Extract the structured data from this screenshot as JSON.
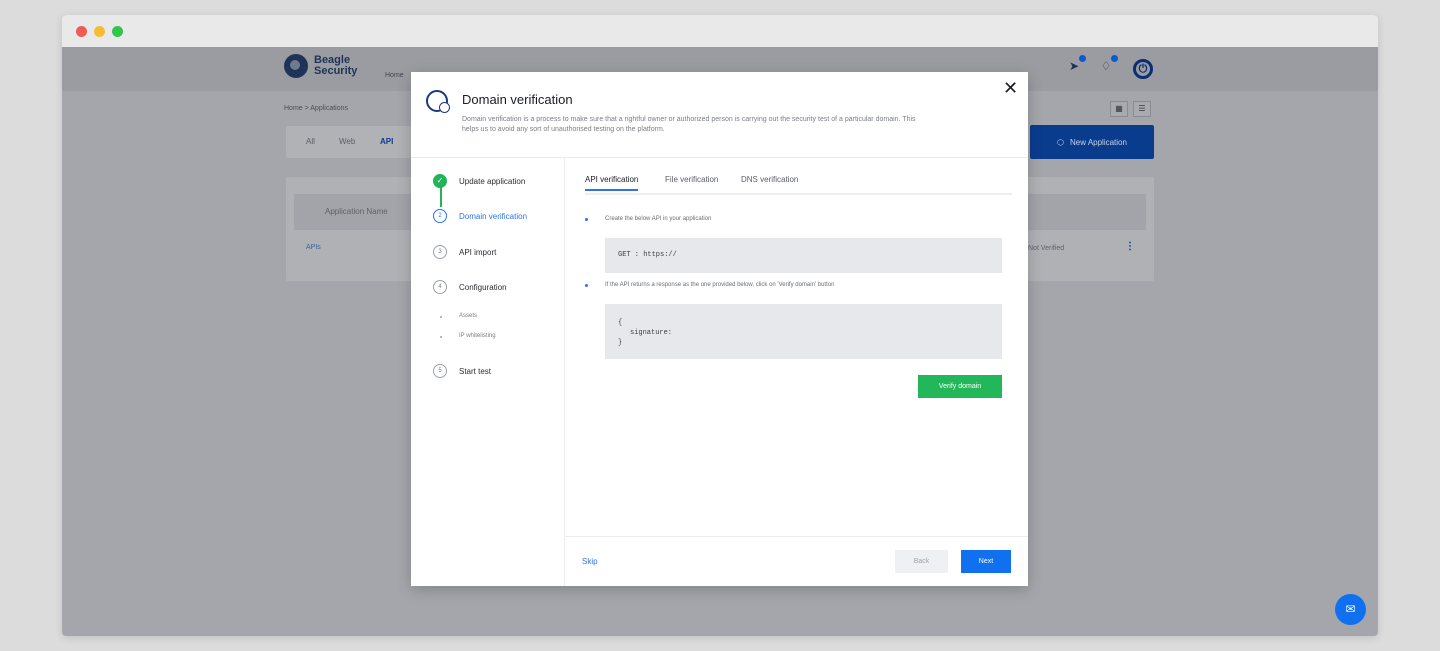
{
  "app": {
    "brand_line1": "Beagle",
    "brand_line2": "Security",
    "nav_home": "Home",
    "breadcrumb": "Home  >  Applications",
    "filters": [
      "All",
      "Web",
      "API"
    ],
    "new_application": "New Application",
    "table_header": "Application Name",
    "row_name": "APIs",
    "row_status": "Not Verified"
  },
  "modal": {
    "title": "Domain verification",
    "description": "Domain verification is a process to make sure that a rightful owner or authorized person is carrying out the security test of a particular domain. This helps us to avoid any sort of unauthorised testing on the platform.",
    "steps": [
      {
        "label": "Update application",
        "num": "✓"
      },
      {
        "label": "Domain verification",
        "num": "2"
      },
      {
        "label": "API import",
        "num": "3"
      },
      {
        "label": "Configuration",
        "num": "4"
      },
      {
        "label": "Start test",
        "num": "5"
      }
    ],
    "sub_steps": [
      "Assets",
      "IP whitelisting"
    ],
    "tabs": [
      "API verification",
      "File verification",
      "DNS verification"
    ],
    "instruction_1": "Create the below API in your application",
    "code_1": "GET : https://",
    "instruction_2": "If the API returns a response as the one provided below, click on 'Verify domain' button",
    "code_2_open": "{",
    "code_2_body": "signature:",
    "code_2_close": "}",
    "verify_button": "Verify domain",
    "skip": "Skip",
    "back": "Back",
    "next": "Next",
    "close_glyph": "✕"
  },
  "colors": {
    "accent": "#2f73e6",
    "success": "#22b85a",
    "primary_button": "#1070f0"
  }
}
